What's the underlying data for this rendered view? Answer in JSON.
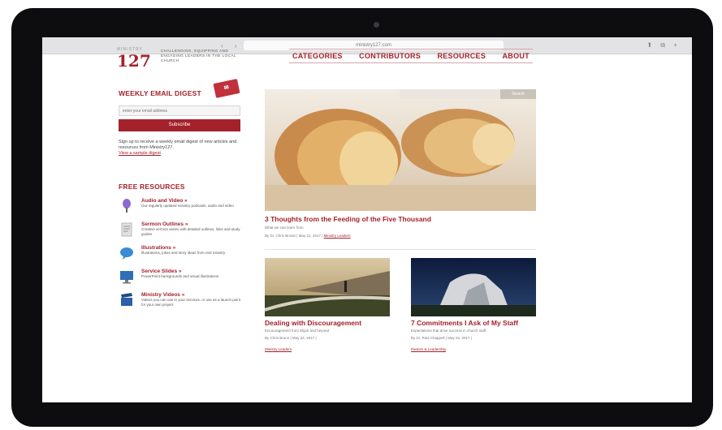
{
  "browser": {
    "nav_icons": "‹ ›",
    "url": "ministry127.com",
    "right_icons": "⬆ ⧉ +"
  },
  "site": {
    "logo_small": "MINISTRY",
    "logo_number": "127",
    "tagline": "CHALLENGING, EQUIPPING AND ENGAGING LEADERS IN THE LOCAL CHURCH"
  },
  "nav": [
    "CATEGORIES",
    "CONTRIBUTORS",
    "RESOURCES",
    "ABOUT"
  ],
  "sidebar": {
    "digest_title": "WEEKLY EMAIL DIGEST",
    "digest_badge": "✉",
    "email_placeholder": "enter your email address",
    "subscribe_label": "Subscribe",
    "description": "Sign up to receive a weekly email digest of new articles and resources from Ministry127.",
    "description_link": "View a sample digest",
    "resources_title": "FREE RESOURCES",
    "resources": [
      {
        "name": "Audio and Video »",
        "desc": "Our regularly updated ministry podcasts, audio and video",
        "icon": "microphone-icon",
        "color": "#8c6ad1"
      },
      {
        "name": "Sermon Outlines »",
        "desc": "Creative sermon series with detailed outlines, links and study guides",
        "icon": "document-icon",
        "color": "#b8b8b8"
      },
      {
        "name": "Illustrations »",
        "desc": "Illustrations, jokes and story ideas from real ministry",
        "icon": "speech-bubble-icon",
        "color": "#3a8ad6"
      },
      {
        "name": "Service Slides »",
        "desc": "PowerPoint backgrounds and visual illustrations",
        "icon": "monitor-icon",
        "color": "#2f6fb8"
      },
      {
        "name": "Ministry Videos »",
        "desc": "Videos you can use in your services, or use as a launch point for your own project",
        "icon": "clapperboard-icon",
        "color": "#2b5fa8"
      }
    ]
  },
  "search": {
    "button": "Search"
  },
  "featured": {
    "title": "3 Thoughts from the Feeding of the Five Thousand",
    "subtitle": "What we can learn from",
    "meta": "By Dr. Chris Brown | May 21, 2017 |",
    "link": "Ministry Leaders"
  },
  "cards": [
    {
      "title": "Dealing with Discouragement",
      "subtitle": "Encouragement from Elijah and beyond",
      "meta": "By Chris Bruno | May 22, 2017 |",
      "link": "Ministry Leaders"
    },
    {
      "title": "7 Commitments I Ask of My Staff",
      "subtitle": "Expectations that drive success in church staff",
      "meta": "By Dr. Paul Chappell | May 22, 2017 |",
      "link": "Pastors & Leadership"
    }
  ],
  "colors": {
    "accent": "#a4212b",
    "bezel": "#0d0d0f"
  }
}
